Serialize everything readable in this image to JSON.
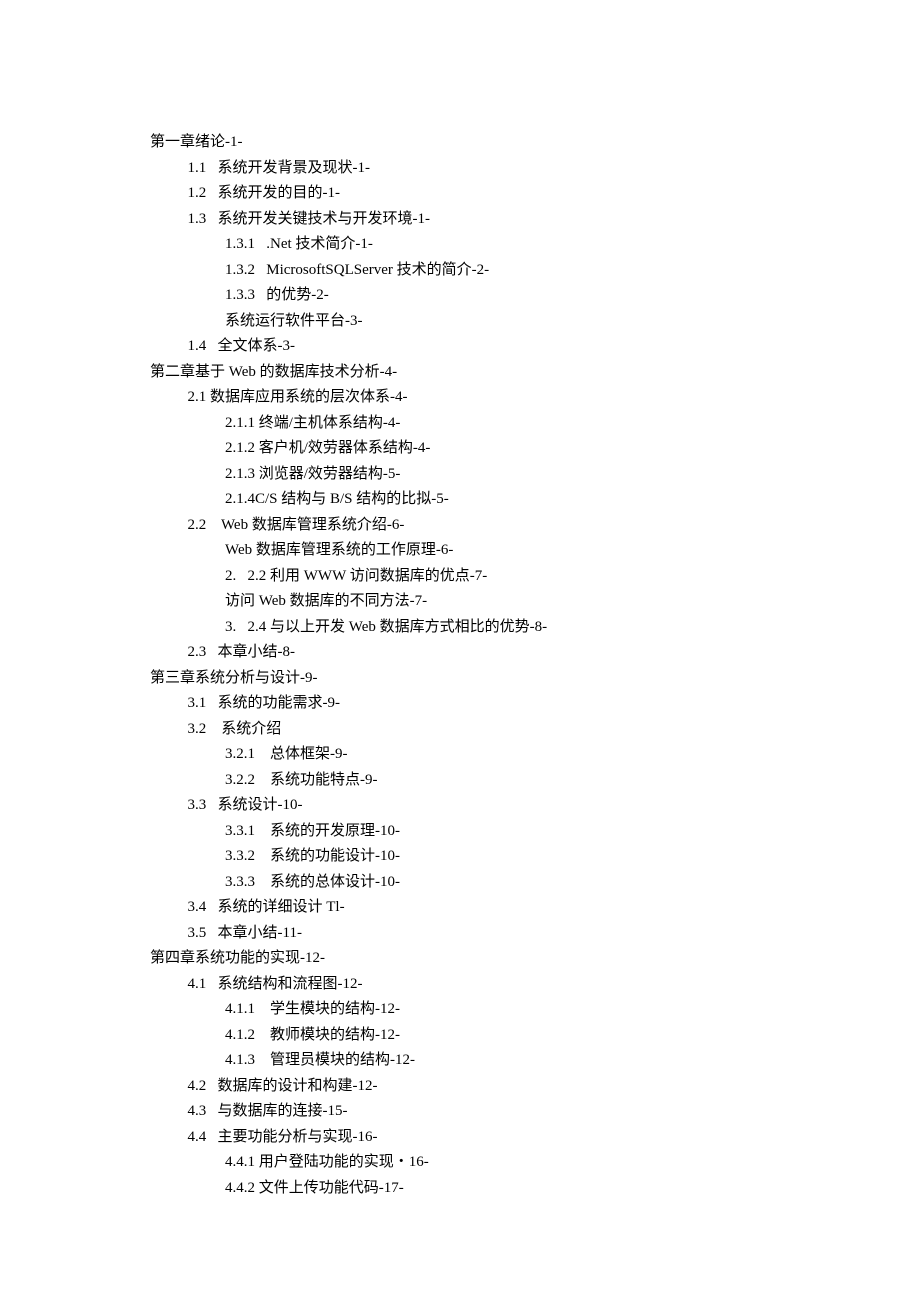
{
  "toc": [
    {
      "level": 0,
      "text": "第一章绪论-1-"
    },
    {
      "level": 1,
      "text": "1.1   系统开发背景及现状-1-"
    },
    {
      "level": 1,
      "text": "1.2   系统开发的目的-1-"
    },
    {
      "level": 1,
      "text": "1.3   系统开发关键技术与开发环境-1-"
    },
    {
      "level": 2,
      "text": "1.3.1   .Net 技术简介-1-"
    },
    {
      "level": 2,
      "text": "1.3.2   MicrosoftSQLServer 技术的简介-2-"
    },
    {
      "level": 2,
      "text": "1.3.3   的优势-2-"
    },
    {
      "level": 2,
      "text": "系统运行软件平台-3-"
    },
    {
      "level": 1,
      "text": "1.4   全文体系-3-"
    },
    {
      "level": 0,
      "text": "第二章基于 Web 的数据库技术分析-4-"
    },
    {
      "level": 1,
      "text": "2.1 数据库应用系统的层次体系-4-"
    },
    {
      "level": 2,
      "text": "2.1.1 终端/主机体系结构-4-"
    },
    {
      "level": 2,
      "text": "2.1.2 客户机/效劳器体系结构-4-"
    },
    {
      "level": 2,
      "text": "2.1.3 浏览器/效劳器结构-5-"
    },
    {
      "level": 2,
      "text": "2.1.4C/S 结构与 B/S 结构的比拟-5-"
    },
    {
      "level": 1,
      "text": "2.2    Web 数据库管理系统介绍-6-"
    },
    {
      "level": 2,
      "text": "Web 数据库管理系统的工作原理-6-"
    },
    {
      "level": 2,
      "text": "2.   2.2 利用 WWW 访问数据库的优点-7-"
    },
    {
      "level": 2,
      "text": "访问 Web 数据库的不同方法-7-"
    },
    {
      "level": 2,
      "text": "3.   2.4 与以上开发 Web 数据库方式相比的优势-8-"
    },
    {
      "level": 1,
      "text": "2.3   本章小结-8-"
    },
    {
      "level": 0,
      "text": "第三章系统分析与设计-9-"
    },
    {
      "level": 1,
      "text": "3.1   系统的功能需求-9-"
    },
    {
      "level": 1,
      "text": "3.2    系统介绍"
    },
    {
      "level": 2,
      "text": "3.2.1    总体框架-9-"
    },
    {
      "level": 2,
      "text": "3.2.2    系统功能特点-9-"
    },
    {
      "level": 1,
      "text": "3.3   系统设计-10-"
    },
    {
      "level": 2,
      "text": "3.3.1    系统的开发原理-10-"
    },
    {
      "level": 2,
      "text": "3.3.2    系统的功能设计-10-"
    },
    {
      "level": 2,
      "text": "3.3.3    系统的总体设计-10-"
    },
    {
      "level": 1,
      "text": "3.4   系统的详细设计 Tl-"
    },
    {
      "level": 1,
      "text": "3.5   本章小结-11-"
    },
    {
      "level": 0,
      "text": "第四章系统功能的实现-12-"
    },
    {
      "level": 1,
      "text": "4.1   系统结构和流程图-12-"
    },
    {
      "level": 2,
      "text": "4.1.1    学生模块的结构-12-"
    },
    {
      "level": 2,
      "text": "4.1.2    教师模块的结构-12-"
    },
    {
      "level": 2,
      "text": "4.1.3    管理员模块的结构-12-"
    },
    {
      "level": 1,
      "text": "4.2   数据库的设计和构建-12-"
    },
    {
      "level": 1,
      "text": "4.3   与数据库的连接-15-"
    },
    {
      "level": 1,
      "text": "4.4   主要功能分析与实现-16-"
    },
    {
      "level": 2,
      "text": "4.4.1 用户登陆功能的实现・16-"
    },
    {
      "level": 2,
      "text": "4.4.2 文件上传功能代码-17-"
    }
  ]
}
